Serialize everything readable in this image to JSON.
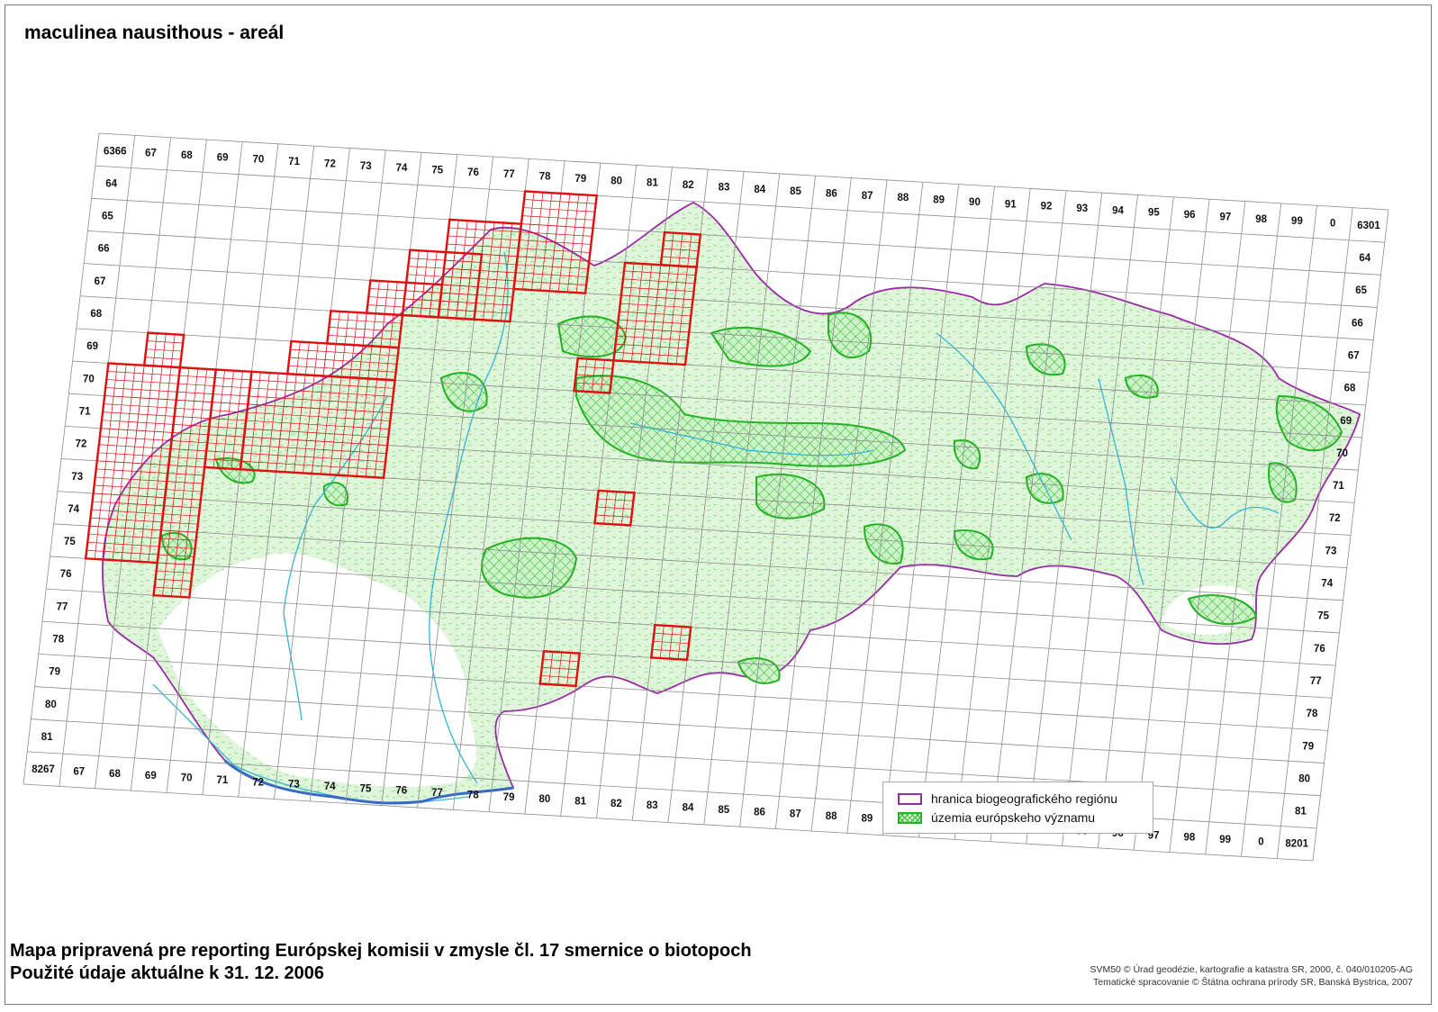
{
  "title": "maculinea nausithous - areál",
  "footer": {
    "line1": "Mapa pripravená pre reporting Európskej komisii v zmysle čl. 17 smernice o biotopoch",
    "line2": "Použité údaje aktuálne k 31. 12. 2006"
  },
  "credits": {
    "line1": "SVM50 © Úrad geodézie, kartografie a katastra SR, 2000, č. 040/010205-AG",
    "line2": "Tematické spracovanie © Štátna ochrana prírody SR, Banská Bystrica, 2007"
  },
  "legend": {
    "boundary_label": "hranica biogeografického regiónu",
    "sites_label": "územia európskeho významu"
  },
  "grid": {
    "top_labels": [
      "6366",
      "67",
      "68",
      "69",
      "70",
      "71",
      "72",
      "73",
      "74",
      "75",
      "76",
      "77",
      "78",
      "79",
      "80",
      "81",
      "82",
      "83",
      "84",
      "85",
      "86",
      "87",
      "88",
      "89",
      "90",
      "91",
      "92",
      "93",
      "94",
      "95",
      "96",
      "97",
      "98",
      "99",
      "0",
      "6301"
    ],
    "bottom_labels": [
      "8267",
      "67",
      "68",
      "69",
      "70",
      "71",
      "72",
      "73",
      "74",
      "75",
      "76",
      "77",
      "78",
      "79",
      "80",
      "81",
      "82",
      "83",
      "84",
      "85",
      "86",
      "87",
      "88",
      "89",
      "90",
      "91",
      "92",
      "93",
      "94",
      "95",
      "96",
      "97",
      "98",
      "99",
      "0",
      "8201"
    ],
    "left_labels": [
      "64",
      "65",
      "66",
      "67",
      "68",
      "69",
      "70",
      "71",
      "72",
      "73",
      "74",
      "75",
      "76",
      "77",
      "78",
      "79",
      "80",
      "81"
    ],
    "right_labels": [
      "64",
      "65",
      "66",
      "67",
      "68",
      "69",
      "70",
      "71",
      "72",
      "73",
      "74",
      "75",
      "76",
      "77",
      "78",
      "79",
      "80",
      "81"
    ]
  },
  "colors": {
    "grid_line": "#8c8c8c",
    "region_boundary": "#9a2aa8",
    "site_fill": "#cdf3c9",
    "site_hatch": "#2fb82f",
    "occurrence_square": "#e01010",
    "river": "#33b5d6"
  },
  "occurrence_squares": [
    {
      "col": 0,
      "row": 7,
      "cols": 2,
      "rows": 6
    },
    {
      "col": 1,
      "row": 6,
      "cols": 1,
      "rows": 1
    },
    {
      "col": 2,
      "row": 7,
      "cols": 1,
      "rows": 7
    },
    {
      "col": 3,
      "row": 7,
      "cols": 1,
      "rows": 3
    },
    {
      "col": 4,
      "row": 7,
      "cols": 4,
      "rows": 3
    },
    {
      "col": 5,
      "row": 6,
      "cols": 3,
      "rows": 1
    },
    {
      "col": 6,
      "row": 5,
      "cols": 2,
      "rows": 1
    },
    {
      "col": 7,
      "row": 4,
      "cols": 2,
      "rows": 1
    },
    {
      "col": 8,
      "row": 3,
      "cols": 2,
      "rows": 2
    },
    {
      "col": 9,
      "row": 2,
      "cols": 2,
      "rows": 3
    },
    {
      "col": 11,
      "row": 1,
      "cols": 2,
      "rows": 3
    },
    {
      "col": 13,
      "row": 6,
      "cols": 1,
      "rows": 1
    },
    {
      "col": 14,
      "row": 3,
      "cols": 2,
      "rows": 3
    },
    {
      "col": 15,
      "row": 2,
      "cols": 1,
      "rows": 1
    },
    {
      "col": 14,
      "row": 10,
      "cols": 1,
      "rows": 1
    },
    {
      "col": 16,
      "row": 14,
      "cols": 1,
      "rows": 1
    },
    {
      "col": 13,
      "row": 15,
      "cols": 1,
      "rows": 1
    }
  ]
}
